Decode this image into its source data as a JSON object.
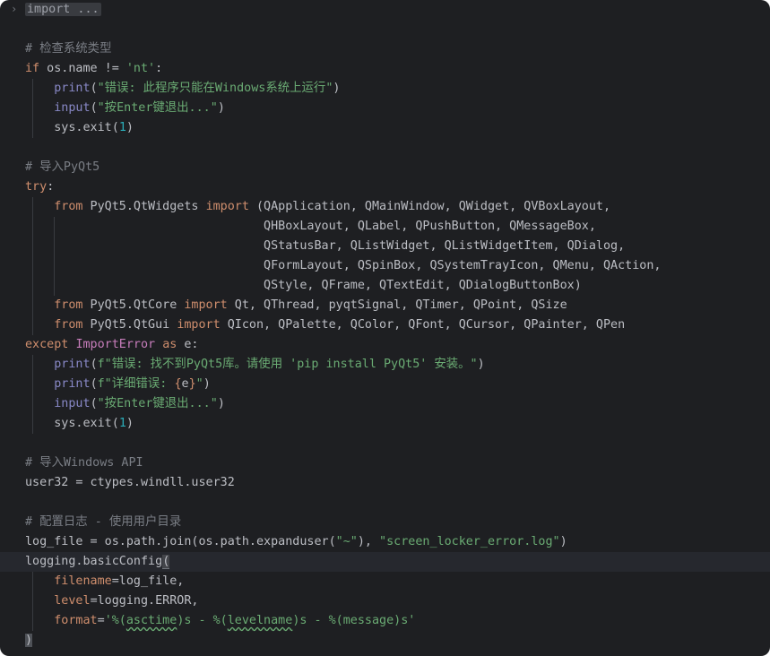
{
  "editor": {
    "lines": [
      [
        {
          "t": "import ...",
          "c": "fold-text"
        }
      ],
      [],
      [
        {
          "t": "# 检查系统类型",
          "c": "cmt"
        }
      ],
      [
        {
          "t": "if",
          "c": "kw"
        },
        {
          "t": " os.name != "
        },
        {
          "t": "'nt'",
          "c": "str"
        },
        {
          "t": ":"
        }
      ],
      [
        {
          "t": "    "
        },
        {
          "t": "print",
          "c": "bi"
        },
        {
          "t": "("
        },
        {
          "t": "\"错误: 此程序只能在Windows系统上运行\"",
          "c": "str"
        },
        {
          "t": ")"
        }
      ],
      [
        {
          "t": "    "
        },
        {
          "t": "input",
          "c": "bi"
        },
        {
          "t": "("
        },
        {
          "t": "\"按Enter键退出...\"",
          "c": "str"
        },
        {
          "t": ")"
        }
      ],
      [
        {
          "t": "    sys.exit("
        },
        {
          "t": "1",
          "c": "num"
        },
        {
          "t": ")"
        }
      ],
      [],
      [
        {
          "t": "# 导入PyQt5",
          "c": "cmt"
        }
      ],
      [
        {
          "t": "try",
          "c": "kw"
        },
        {
          "t": ":"
        }
      ],
      [
        {
          "t": "    "
        },
        {
          "t": "from",
          "c": "kw"
        },
        {
          "t": " PyQt5.QtWidgets "
        },
        {
          "t": "import",
          "c": "kw"
        },
        {
          "t": " (QApplication, QMainWindow, QWidget, QVBoxLayout,"
        }
      ],
      [
        {
          "t": "                                 QHBoxLayout, QLabel, QPushButton, QMessageBox,"
        }
      ],
      [
        {
          "t": "                                 QStatusBar, QListWidget, QListWidgetItem, QDialog,"
        }
      ],
      [
        {
          "t": "                                 QFormLayout, QSpinBox, QSystemTrayIcon, QMenu, QAction,"
        }
      ],
      [
        {
          "t": "                                 QStyle, QFrame, QTextEdit, QDialogButtonBox)"
        }
      ],
      [
        {
          "t": "    "
        },
        {
          "t": "from",
          "c": "kw"
        },
        {
          "t": " PyQt5.QtCore "
        },
        {
          "t": "import",
          "c": "kw"
        },
        {
          "t": " Qt, QThread, pyqtSignal, QTimer, QPoint, QSize"
        }
      ],
      [
        {
          "t": "    "
        },
        {
          "t": "from",
          "c": "kw"
        },
        {
          "t": " PyQt5.QtGui "
        },
        {
          "t": "import",
          "c": "kw"
        },
        {
          "t": " QIcon, QPalette, QColor, QFont, QCursor, QPainter, QPen"
        }
      ],
      [
        {
          "t": "except",
          "c": "kw"
        },
        {
          "t": " "
        },
        {
          "t": "ImportError",
          "c": "cls"
        },
        {
          "t": " "
        },
        {
          "t": "as",
          "c": "kw"
        },
        {
          "t": " e:"
        }
      ],
      [
        {
          "t": "    "
        },
        {
          "t": "print",
          "c": "bi"
        },
        {
          "t": "("
        },
        {
          "t": "f\"错误: 找不到PyQt5库。请使用 'pip install PyQt5' 安装。\"",
          "c": "str"
        },
        {
          "t": ")"
        }
      ],
      [
        {
          "t": "    "
        },
        {
          "t": "print",
          "c": "bi"
        },
        {
          "t": "("
        },
        {
          "t": "f\"详细错误: ",
          "c": "str"
        },
        {
          "t": "{",
          "c": "fmt-braces"
        },
        {
          "t": "e"
        },
        {
          "t": "}",
          "c": "fmt-braces"
        },
        {
          "t": "\"",
          "c": "str"
        },
        {
          "t": ")"
        }
      ],
      [
        {
          "t": "    "
        },
        {
          "t": "input",
          "c": "bi"
        },
        {
          "t": "("
        },
        {
          "t": "\"按Enter键退出...\"",
          "c": "str"
        },
        {
          "t": ")"
        }
      ],
      [
        {
          "t": "    sys.exit("
        },
        {
          "t": "1",
          "c": "num"
        },
        {
          "t": ")"
        }
      ],
      [],
      [
        {
          "t": "# 导入Windows API",
          "c": "cmt"
        }
      ],
      [
        {
          "t": "user32 = ctypes.windll.user32"
        }
      ],
      [],
      [
        {
          "t": "# 配置日志 - 使用用户目录",
          "c": "cmt"
        }
      ],
      [
        {
          "t": "log_file = os.path.join(os.path.expanduser("
        },
        {
          "t": "\"~\"",
          "c": "str"
        },
        {
          "t": "), "
        },
        {
          "t": "\"screen_locker_error.log\"",
          "c": "str"
        },
        {
          "t": ")"
        }
      ],
      [
        {
          "t": "logging.basicConfig"
        },
        {
          "t": "(",
          "c": "brace-hl"
        }
      ],
      [
        {
          "t": "    "
        },
        {
          "t": "filename",
          "c": "param2"
        },
        {
          "t": "=log_file,"
        }
      ],
      [
        {
          "t": "    "
        },
        {
          "t": "level",
          "c": "param2"
        },
        {
          "t": "=logging.ERROR,"
        }
      ],
      [
        {
          "t": "    "
        },
        {
          "t": "format",
          "c": "param2"
        },
        {
          "t": "="
        },
        {
          "t": "'%(",
          "c": "str"
        },
        {
          "t": "asctime",
          "c": "str squiggle"
        },
        {
          "t": ")s - %(",
          "c": "str"
        },
        {
          "t": "levelname",
          "c": "str squiggle"
        },
        {
          "t": ")s - %(message)s'",
          "c": "str"
        }
      ],
      [
        {
          "t": ")",
          "c": "caret-bracket"
        }
      ]
    ],
    "current_line": 28,
    "fold_glyph": "›"
  }
}
